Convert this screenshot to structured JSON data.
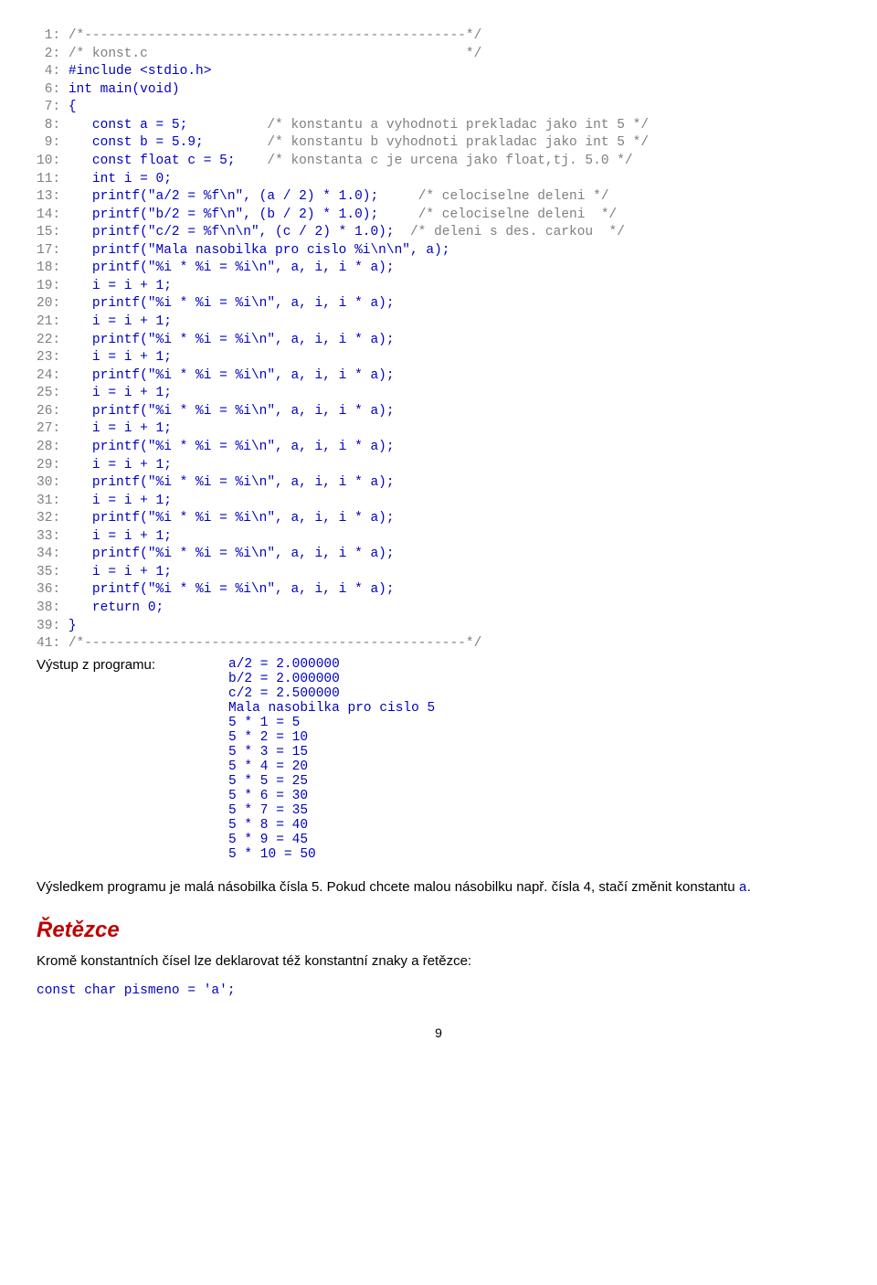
{
  "code": [
    {
      "n": " 1:",
      "pre": " ",
      "kw": "",
      "rest": "/*------------------------------------------------*/"
    },
    {
      "n": " 2:",
      "pre": " ",
      "kw": "",
      "rest": "/* konst.c                                        */"
    },
    {
      "n": " 4:",
      "pre": " ",
      "kw": "#include <stdio.h>",
      "rest": ""
    },
    {
      "n": " 6:",
      "pre": " ",
      "kw": "int main(void)",
      "rest": ""
    },
    {
      "n": " 7:",
      "pre": " ",
      "kw": "{",
      "rest": ""
    },
    {
      "n": " 8:",
      "pre": "    ",
      "kw": "const a = 5;",
      "rest": "          /* konstantu a vyhodnoti prekladac jako int 5 */"
    },
    {
      "n": " 9:",
      "pre": "    ",
      "kw": "const b = 5.9;",
      "rest": "        /* konstantu b vyhodnoti prakladac jako int 5 */"
    },
    {
      "n": "10:",
      "pre": "    ",
      "kw": "const float c = 5;",
      "rest": "    /* konstanta c je urcena jako float,tj. 5.0 */"
    },
    {
      "n": "11:",
      "pre": "    ",
      "kw": "int i = 0;",
      "rest": ""
    },
    {
      "n": "13:",
      "pre": "    ",
      "kw": "printf(\"a/2 = %f\\n\", (a / 2) * 1.0);",
      "rest": "     /* celociselne deleni */"
    },
    {
      "n": "14:",
      "pre": "    ",
      "kw": "printf(\"b/2 = %f\\n\", (b / 2) * 1.0);",
      "rest": "     /* celociselne deleni  */"
    },
    {
      "n": "15:",
      "pre": "    ",
      "kw": "printf(\"c/2 = %f\\n\\n\", (c / 2) * 1.0);",
      "rest": "  /* deleni s des. carkou  */"
    },
    {
      "n": "17:",
      "pre": "    ",
      "kw": "printf(\"Mala nasobilka pro cislo %i\\n\\n\", a);",
      "rest": ""
    },
    {
      "n": "18:",
      "pre": "    ",
      "kw": "printf(\"%i * %i = %i\\n\", a, i, i * a);",
      "rest": ""
    },
    {
      "n": "19:",
      "pre": "    ",
      "kw": "i = i + 1;",
      "rest": ""
    },
    {
      "n": "20:",
      "pre": "    ",
      "kw": "printf(\"%i * %i = %i\\n\", a, i, i * a);",
      "rest": ""
    },
    {
      "n": "21:",
      "pre": "    ",
      "kw": "i = i + 1;",
      "rest": ""
    },
    {
      "n": "22:",
      "pre": "    ",
      "kw": "printf(\"%i * %i = %i\\n\", a, i, i * a);",
      "rest": ""
    },
    {
      "n": "23:",
      "pre": "    ",
      "kw": "i = i + 1;",
      "rest": ""
    },
    {
      "n": "24:",
      "pre": "    ",
      "kw": "printf(\"%i * %i = %i\\n\", a, i, i * a);",
      "rest": ""
    },
    {
      "n": "25:",
      "pre": "    ",
      "kw": "i = i + 1;",
      "rest": ""
    },
    {
      "n": "26:",
      "pre": "    ",
      "kw": "printf(\"%i * %i = %i\\n\", a, i, i * a);",
      "rest": ""
    },
    {
      "n": "27:",
      "pre": "    ",
      "kw": "i = i + 1;",
      "rest": ""
    },
    {
      "n": "28:",
      "pre": "    ",
      "kw": "printf(\"%i * %i = %i\\n\", a, i, i * a);",
      "rest": ""
    },
    {
      "n": "29:",
      "pre": "    ",
      "kw": "i = i + 1;",
      "rest": ""
    },
    {
      "n": "30:",
      "pre": "    ",
      "kw": "printf(\"%i * %i = %i\\n\", a, i, i * a);",
      "rest": ""
    },
    {
      "n": "31:",
      "pre": "    ",
      "kw": "i = i + 1;",
      "rest": ""
    },
    {
      "n": "32:",
      "pre": "    ",
      "kw": "printf(\"%i * %i = %i\\n\", a, i, i * a);",
      "rest": ""
    },
    {
      "n": "33:",
      "pre": "    ",
      "kw": "i = i + 1;",
      "rest": ""
    },
    {
      "n": "34:",
      "pre": "    ",
      "kw": "printf(\"%i * %i = %i\\n\", a, i, i * a);",
      "rest": ""
    },
    {
      "n": "35:",
      "pre": "    ",
      "kw": "i = i + 1;",
      "rest": ""
    },
    {
      "n": "36:",
      "pre": "    ",
      "kw": "printf(\"%i * %i = %i\\n\", a, i, i * a);",
      "rest": ""
    },
    {
      "n": "38:",
      "pre": "    ",
      "kw": "return 0;",
      "rest": ""
    },
    {
      "n": "39:",
      "pre": " ",
      "kw": "}",
      "rest": ""
    },
    {
      "n": "41:",
      "pre": " ",
      "kw": "",
      "rest": "/*------------------------------------------------*/"
    }
  ],
  "output_label": "Výstup z programu:",
  "output_lines": [
    "a/2 = 2.000000",
    "b/2 = 2.000000",
    "c/2 = 2.500000",
    "Mala nasobilka pro cislo 5",
    "5 * 1 = 5",
    "5 * 2 = 10",
    "5 * 3 = 15",
    "5 * 4 = 20",
    "5 * 5 = 25",
    "5 * 6 = 30",
    "5 * 7 = 35",
    "5 * 8 = 40",
    "5 * 9 = 45",
    "5 * 10 = 50"
  ],
  "result_para_pre": "Výsledkem programu je malá násobilka čísla 5. Pokud chcete malou násobilku např. čísla 4, stačí změnit konstantu ",
  "result_para_const": "a",
  "result_para_post": ".",
  "heading": "Řetězce",
  "strings_para": "Kromě konstantních čísel lze deklarovat též  konstantní znaky a řetězce:",
  "decl": "const char pismeno = 'a';",
  "page_number": "9"
}
